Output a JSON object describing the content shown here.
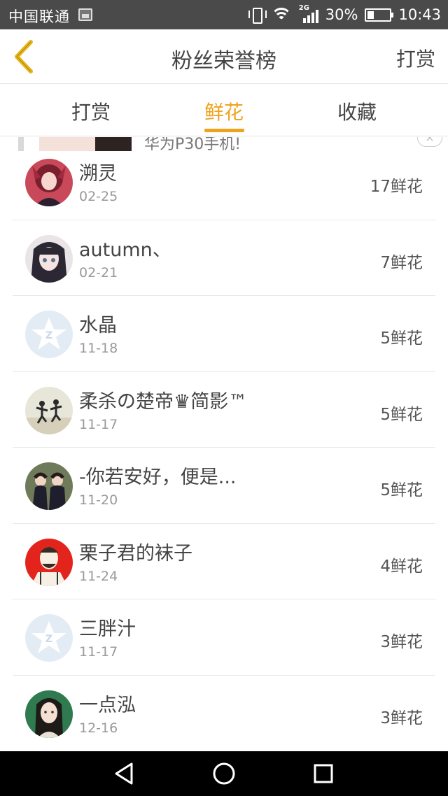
{
  "status_bar": {
    "carrier": "中国联通",
    "network_tag": "2G",
    "battery_percent": "30%",
    "battery_level": 0.3,
    "time": "10:43",
    "icons": [
      "image-icon",
      "vibrate-icon",
      "wifi-icon",
      "signal-icon",
      "battery-icon"
    ]
  },
  "header": {
    "back_icon": "chevron-left-icon",
    "title": "粉丝荣誉榜",
    "action_label": "打赏"
  },
  "tabs": [
    {
      "label": "打赏",
      "active": false
    },
    {
      "label": "鲜花",
      "active": true
    },
    {
      "label": "收藏",
      "active": false
    }
  ],
  "ad": {
    "text": "华为P30手机!",
    "close": "×"
  },
  "list": [
    {
      "name": "溯灵",
      "date": "02-25",
      "count": "17鲜花",
      "avatar": "anime-girl-red"
    },
    {
      "name": "autumn、",
      "date": "02-21",
      "count": "7鲜花",
      "avatar": "anime-girl-dark-hair"
    },
    {
      "name": "水晶",
      "date": "11-18",
      "count": "5鲜花",
      "avatar": "default-star"
    },
    {
      "name": "柔杀の楚帝♛简影™",
      "date": "11-17",
      "count": "5鲜花",
      "avatar": "two-people-jumping"
    },
    {
      "name": "-你若安好，便是...",
      "date": "11-20",
      "count": "5鲜花",
      "avatar": "two-girls-photo"
    },
    {
      "name": "栗子君的袜子",
      "date": "11-24",
      "count": "4鲜花",
      "avatar": "cartoon-man-red"
    },
    {
      "name": "三胖汁",
      "date": "11-17",
      "count": "3鲜花",
      "avatar": "default-star"
    },
    {
      "name": "一点泓",
      "date": "12-16",
      "count": "3鲜花",
      "avatar": "woman-green-bg"
    }
  ],
  "colors": {
    "accent": "#f0a21b",
    "back_icon": "#e8b51c",
    "status_bar": "#4a4a4a"
  }
}
